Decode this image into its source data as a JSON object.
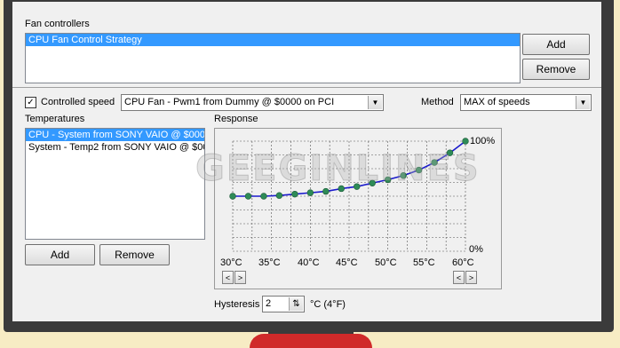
{
  "fan_controllers": {
    "group_label": "Fan controllers",
    "items": [
      "CPU Fan Control Strategy"
    ],
    "add_label": "Add",
    "remove_label": "Remove"
  },
  "controlled_speed": {
    "checkbox_label": "Controlled speed",
    "checked": true,
    "fan_select": "CPU Fan - Pwm1 from Dummy @ $0000 on PCI",
    "method_label": "Method",
    "method_select": "MAX of speeds"
  },
  "temperatures": {
    "label": "Temperatures",
    "items": [
      "CPU - System from SONY VAIO @ $000",
      "System - Temp2 from SONY VAIO @ $00"
    ],
    "add_label": "Add",
    "remove_label": "Remove"
  },
  "response": {
    "label": "Response",
    "y_top_label": "100%",
    "y_bottom_label": "0%",
    "x_tick_labels": [
      "30°C",
      "35°C",
      "40°C",
      "45°C",
      "50°C",
      "55°C",
      "60°C"
    ]
  },
  "hysteresis": {
    "label": "Hysteresis",
    "value": "2",
    "unit_label": "°C (4°F)"
  },
  "watermark": "GEEGINLINES",
  "colors": {
    "curve": "#1a1acc",
    "point": "#2e8b57",
    "selection": "#3399ff"
  },
  "chart_data": {
    "type": "line",
    "x": [
      30,
      32,
      34,
      36,
      38,
      40,
      42,
      44,
      46,
      48,
      50,
      52,
      54,
      56,
      58,
      60
    ],
    "y": [
      0,
      0,
      0,
      1,
      3,
      5,
      7,
      11,
      14,
      19,
      24,
      30,
      38,
      49,
      63,
      80
    ],
    "y_axis": "Response",
    "x_range": [
      30,
      60
    ],
    "y_range": [
      -80,
      80
    ],
    "grid": true
  }
}
